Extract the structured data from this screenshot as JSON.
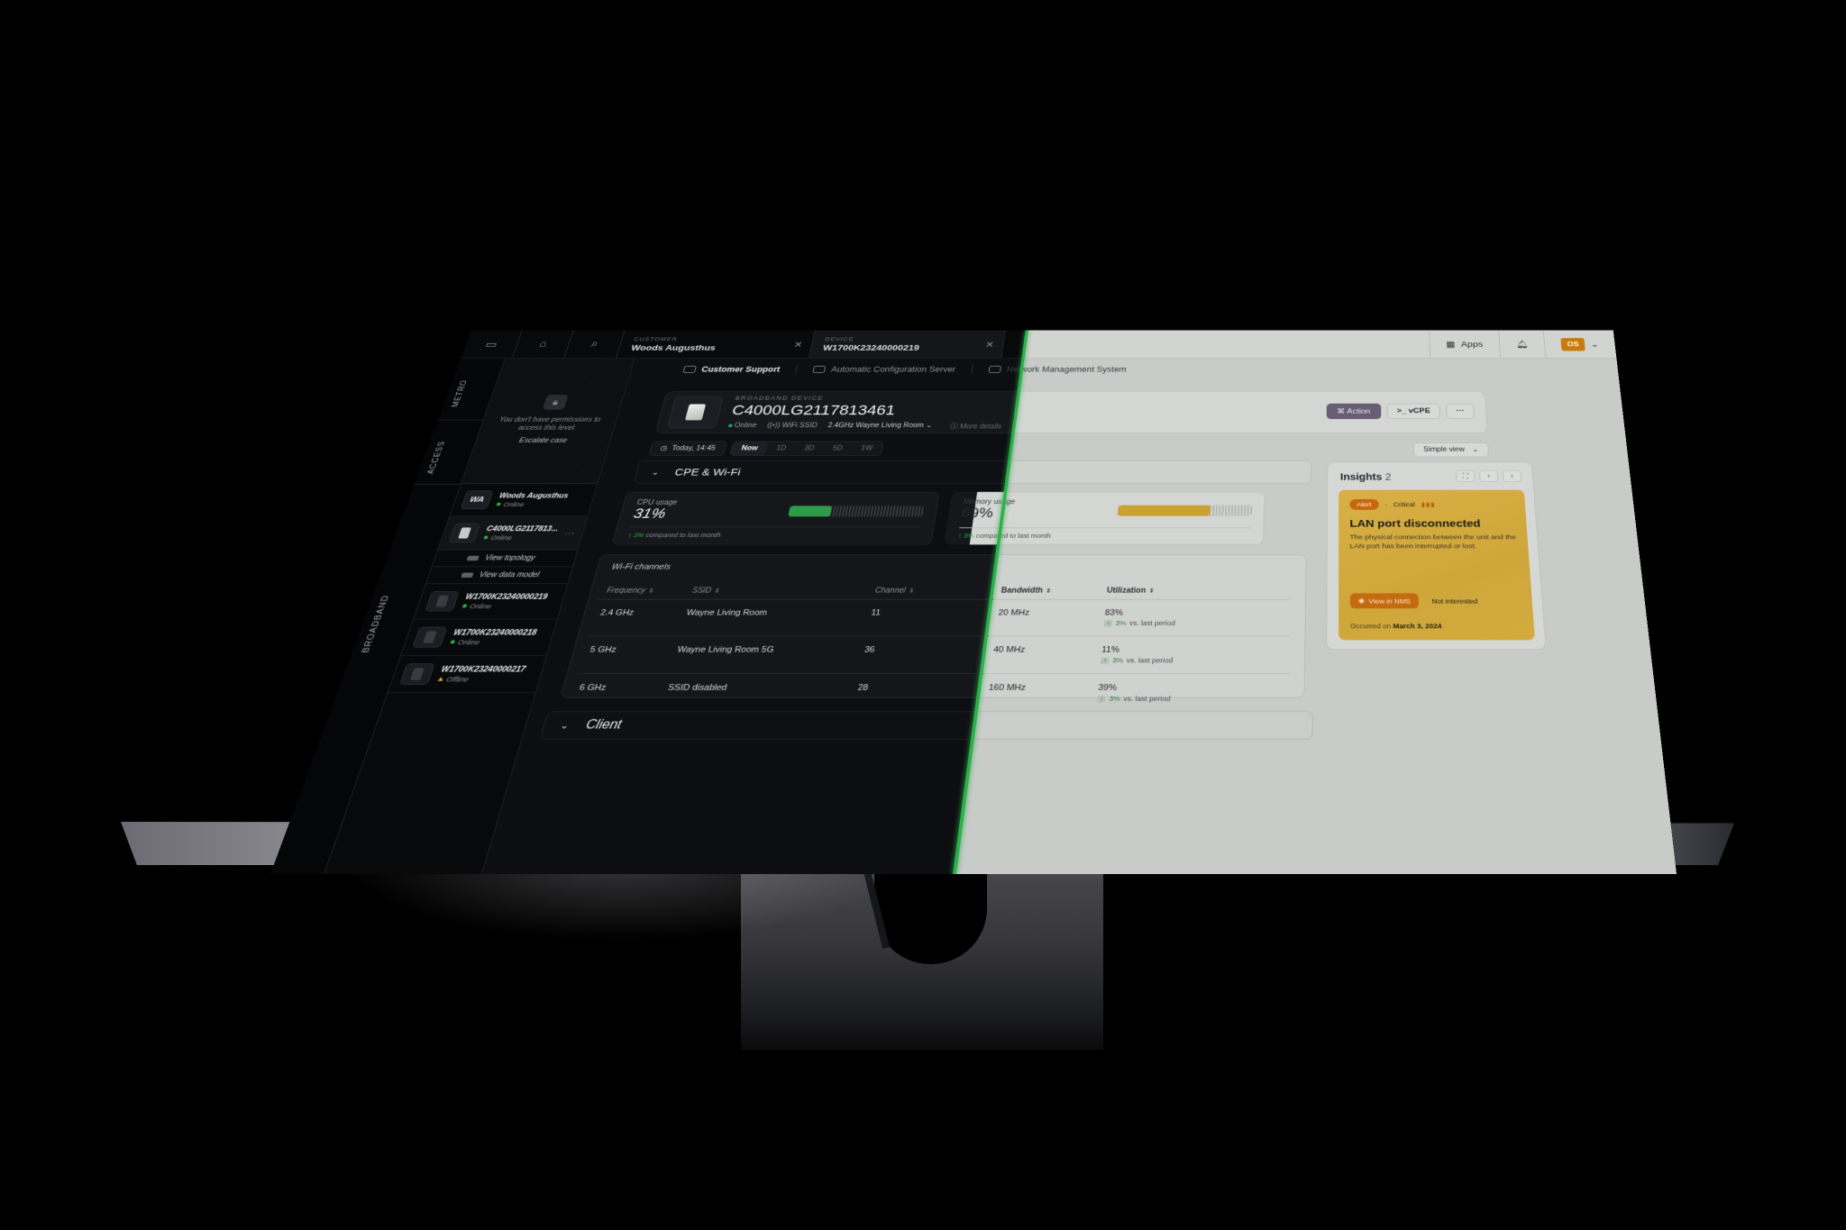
{
  "topbar": {
    "tabs": [
      {
        "kicker": "Customer",
        "value": "Woods Augusthus"
      },
      {
        "kicker": "Device",
        "value": "W1700K23240000219"
      }
    ],
    "apps_label": "Apps",
    "avatar_initials": "OS"
  },
  "subnav": {
    "items": [
      {
        "label": "Customer Support",
        "active": true
      },
      {
        "label": "Automatic Configuration Server",
        "active": false
      },
      {
        "label": "Network Management System",
        "active": false
      }
    ]
  },
  "rail": {
    "levels": [
      "METRO",
      "ACCESS",
      "BROADBAND"
    ]
  },
  "sidebar": {
    "locked_message": "You don't have permissions to access this level.",
    "escalate_label": "Escalate case",
    "customer": {
      "initials": "WA",
      "name": "Woods Augusthus",
      "status": "Online"
    },
    "selected_device": {
      "name": "C4000LG2117813...",
      "status": "Online"
    },
    "links": [
      "View topology",
      "View data model"
    ],
    "devices": [
      {
        "name": "W1700K23240000219",
        "status": "Online"
      },
      {
        "name": "W1700K23240000218",
        "status": "Online"
      },
      {
        "name": "W1700K23240000217",
        "status": "Offline"
      }
    ]
  },
  "device": {
    "kicker": "BROADBAND DEVICE",
    "title": "C4000LG2117813461",
    "status": "Online",
    "ssid_label": "WiFi SSID",
    "ssid_value": "2.4GHz Wayne Living Room",
    "more_details": "More details",
    "actions": {
      "action": "Action",
      "vcpe": "vCPE",
      "more": "···"
    }
  },
  "time": {
    "current": "Today, 14:45",
    "ranges": [
      "Now",
      "1D",
      "3D",
      "5D",
      "1W"
    ],
    "selected_range": "Now"
  },
  "view_select": "Simple view",
  "sections": {
    "cpe_wifi": "CPE & Wi-Fi",
    "client": "Client"
  },
  "metrics": {
    "cpu": {
      "label": "CPU usage",
      "value": "31%",
      "percent": 31,
      "delta": "3%",
      "delta_text": "compared to last month",
      "color": "#2e9b48"
    },
    "memory": {
      "label": "Memory usage",
      "value": "69%",
      "percent": 69,
      "delta": "3%",
      "delta_text": "compared to last month",
      "color": "#c9a232"
    }
  },
  "wifi": {
    "title": "Wi-Fi channels",
    "columns": [
      "Frequency",
      "SSID",
      "Channel",
      "Bandwidth",
      "Utilization"
    ],
    "rows": [
      {
        "frequency": "2.4 GHz",
        "ssid": "Wayne Living Room",
        "channel": "11",
        "bandwidth": "20 MHz",
        "utilization": "83%",
        "delta": "3%",
        "delta_text": "vs. last period"
      },
      {
        "frequency": "5 GHz",
        "ssid": "Wayne Living Room 5G",
        "channel": "36",
        "bandwidth": "40 MHz",
        "utilization": "11%",
        "delta": "3%",
        "delta_text": "vs. last period"
      },
      {
        "frequency": "6 GHz",
        "ssid": "SSID disabled",
        "channel": "28",
        "bandwidth": "160 MHz",
        "utilization": "39%",
        "delta": "3%",
        "delta_text": "vs. last period"
      }
    ]
  },
  "insights": {
    "title": "Insights",
    "count": "2",
    "alert": {
      "badge": "Alert",
      "severity": "Critical",
      "title": "LAN port disconnected",
      "description": "The physical connection between the unit and the LAN port has been interrupted or lost.",
      "primary": "View in NMS",
      "secondary": "Not interested",
      "occurred_prefix": "Occurred on",
      "occurred_date": "March 3, 2024"
    }
  },
  "colors": {
    "accent_green": "#2bb04a",
    "alert_orange": "#c6660e",
    "alert_card": "#d2ab3f",
    "action_button": "#675e73"
  }
}
